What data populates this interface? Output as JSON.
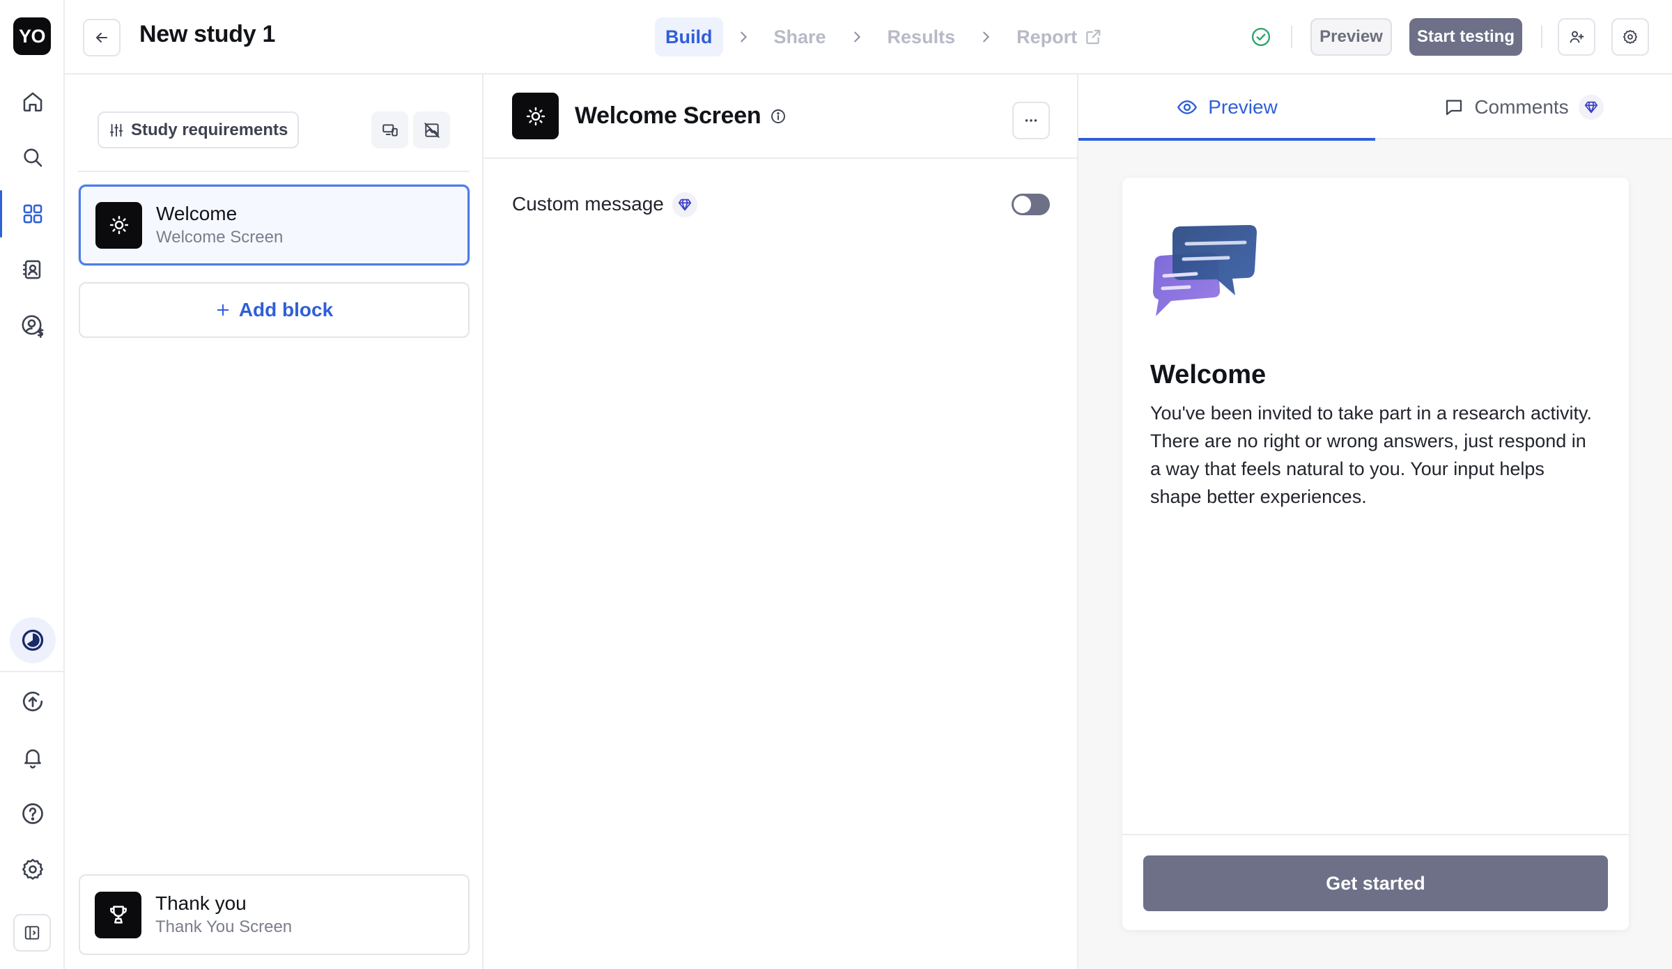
{
  "app": {
    "logo_text": "YO",
    "study_title": "New study 1"
  },
  "rail": {
    "items": [
      {
        "name": "home-icon"
      },
      {
        "name": "search-icon"
      },
      {
        "name": "grid-icon",
        "active": true
      },
      {
        "name": "contacts-icon"
      },
      {
        "name": "user-dollar-icon"
      },
      {
        "name": "progress-icon"
      },
      {
        "name": "upload-icon"
      },
      {
        "name": "bell-icon"
      },
      {
        "name": "help-icon"
      },
      {
        "name": "gear-icon"
      },
      {
        "name": "collapse-sidebar-icon"
      }
    ]
  },
  "steps": [
    {
      "label": "Build",
      "active": true
    },
    {
      "label": "Share",
      "active": false
    },
    {
      "label": "Results",
      "active": false
    },
    {
      "label": "Report",
      "active": false,
      "icon": "external-link-icon"
    }
  ],
  "toolbar": {
    "preview_label": "Preview",
    "start_label": "Start testing",
    "status_icon": "check-circle-icon"
  },
  "left_panel": {
    "requirements_label": "Study requirements",
    "blocks": [
      {
        "name": "Welcome",
        "type": "Welcome Screen",
        "icon": "sun-icon",
        "selected": true
      },
      {
        "name": "Thank you",
        "type": "Thank You Screen",
        "icon": "trophy-icon",
        "selected": false
      }
    ],
    "add_block_label": "Add block"
  },
  "editor": {
    "title": "Welcome Screen",
    "custom_message_label": "Custom message",
    "custom_message_enabled": false
  },
  "preview_panel": {
    "tabs": [
      {
        "label": "Preview",
        "icon": "eye-icon",
        "active": true
      },
      {
        "label": "Comments",
        "icon": "comment-icon",
        "active": false
      }
    ],
    "card": {
      "title": "Welcome",
      "body": "You've been invited to take part in a research activity. There are no right or wrong answers, just respond in a way that feels natural to you. Your input helps shape better experiences.",
      "cta_label": "Get started"
    }
  },
  "colors": {
    "accent": "#2f5fd7",
    "primary_button": "#6d7087",
    "logo_bg": "#0b0b0d",
    "premium_gem": "#3b3fc6",
    "status_ok": "#2fa66a"
  }
}
